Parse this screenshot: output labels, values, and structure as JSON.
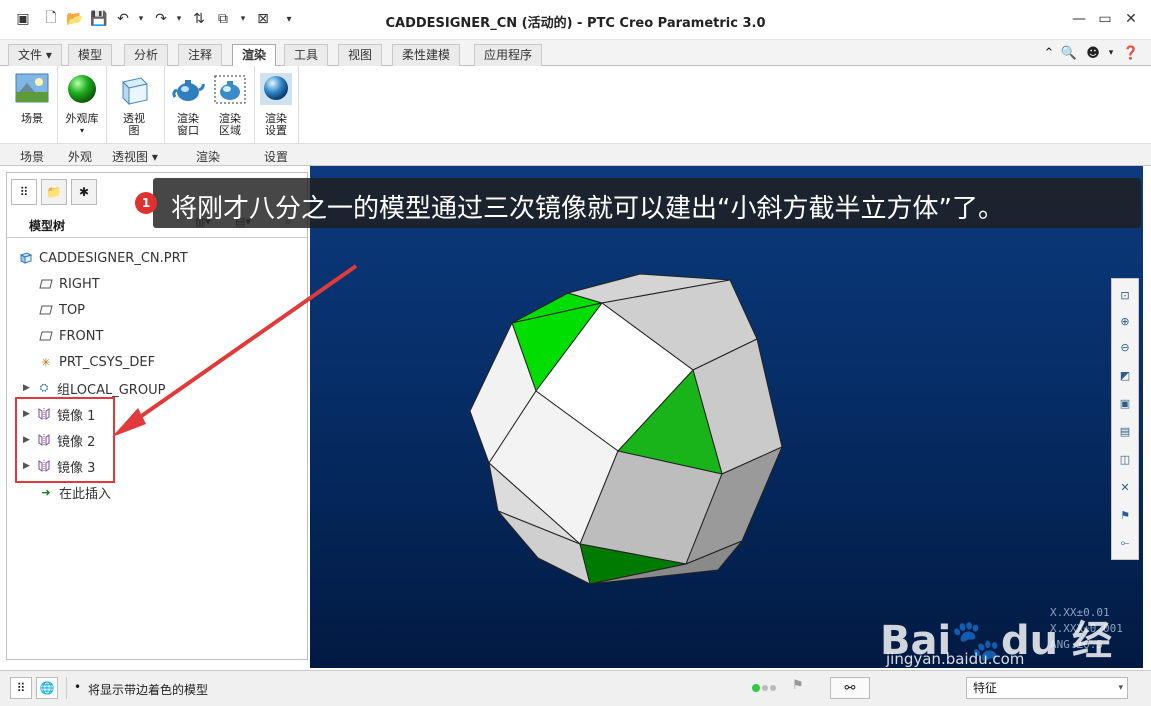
{
  "window": {
    "title": "CADDESIGNER_CN (活动的) - PTC Creo Parametric 3.0"
  },
  "ribbon_tabs": [
    {
      "label": "文件",
      "id": "file"
    },
    {
      "label": "模型",
      "id": "model"
    },
    {
      "label": "分析",
      "id": "analysis"
    },
    {
      "label": "注释",
      "id": "annotate"
    },
    {
      "label": "渲染",
      "id": "render",
      "active": true
    },
    {
      "label": "工具",
      "id": "tools"
    },
    {
      "label": "视图",
      "id": "view"
    },
    {
      "label": "柔性建模",
      "id": "flex"
    },
    {
      "label": "应用程序",
      "id": "apps"
    }
  ],
  "ribbon": {
    "buttons": {
      "scene": "场景",
      "appearance": "外观库",
      "perspective": "透视图",
      "render_window": "渲染窗口",
      "render_region": "渲染区域",
      "render_setup": "渲染设置"
    },
    "groups": {
      "scene": "场景",
      "appearance": "外观",
      "perspective": "透视图",
      "render": "渲染",
      "setup": "设置"
    }
  },
  "model_tree": {
    "title": "模型树",
    "items": [
      {
        "label": "CADDESIGNER_CN.PRT",
        "icon": "part-icon"
      },
      {
        "label": "RIGHT",
        "icon": "datum-plane-icon"
      },
      {
        "label": "TOP",
        "icon": "datum-plane-icon"
      },
      {
        "label": "FRONT",
        "icon": "datum-plane-icon"
      },
      {
        "label": "PRT_CSYS_DEF",
        "icon": "csys-icon"
      },
      {
        "label": "组LOCAL_GROUP",
        "icon": "group-icon"
      },
      {
        "label": "镜像 1",
        "icon": "mirror-icon"
      },
      {
        "label": "镜像 2",
        "icon": "mirror-icon"
      },
      {
        "label": "镜像 3",
        "icon": "mirror-icon"
      },
      {
        "label": "在此插入",
        "icon": "insert-arrow-icon"
      }
    ]
  },
  "caption": {
    "badge": "1",
    "text": "将刚才八分之一的模型通过三次镜像就可以建出“小斜方截半立方体”了。"
  },
  "tolerances": [
    "X.XX±0.01",
    "X.XXX±0.001",
    "ANG.±0.5"
  ],
  "watermark": {
    "main": "Bai🐾du 经验",
    "url": "jingyan.baidu.com"
  },
  "status": {
    "message": "将显示带边着色的模型",
    "filter": "特征"
  },
  "colors": {
    "accent_green": "#18c018",
    "highlight_red": "#e13a3a",
    "viewport_top": "#0c3a7d",
    "viewport_bottom": "#021a42"
  }
}
